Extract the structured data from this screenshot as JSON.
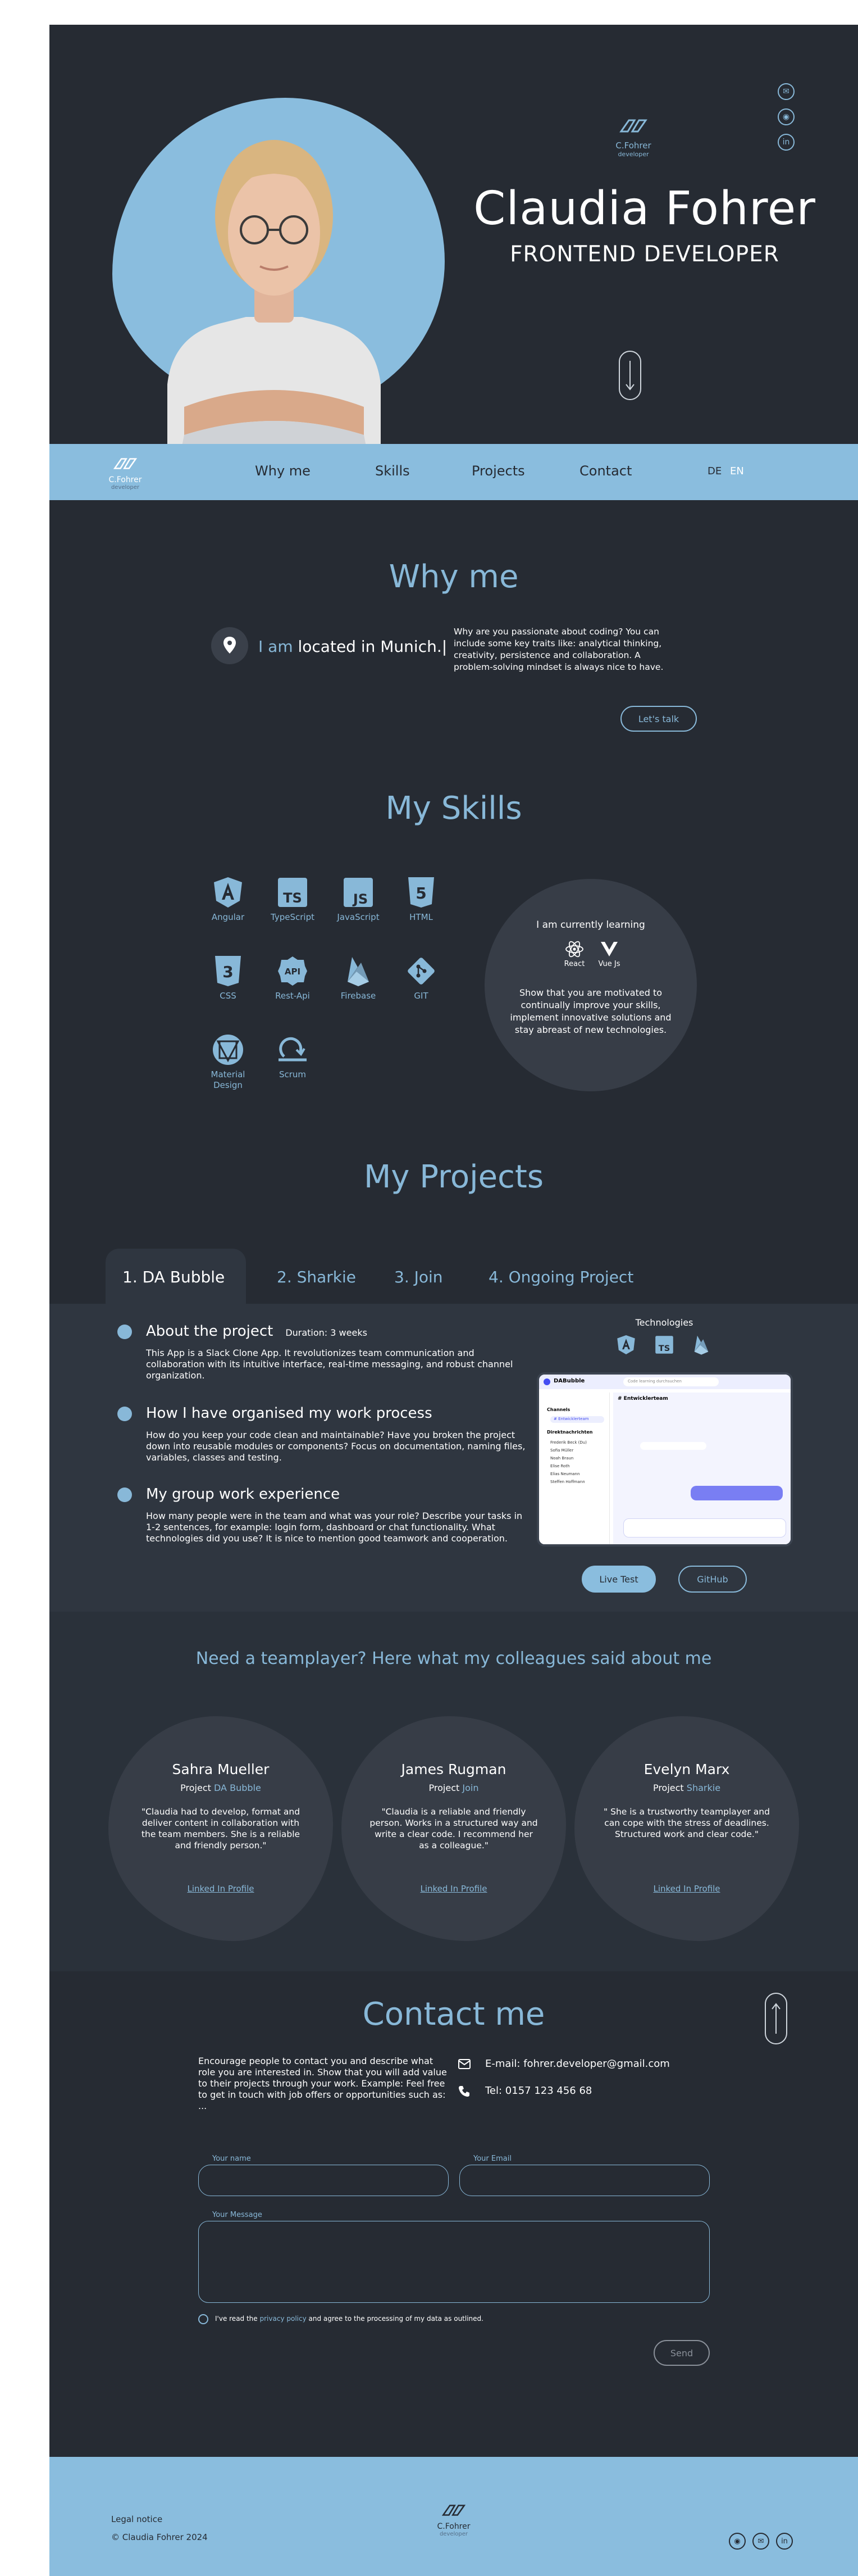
{
  "hero": {
    "brand_name": "C.Fohrer",
    "brand_sub": "developer",
    "name": "Claudia Fohrer",
    "role": "FRONTEND DEVELOPER"
  },
  "nav": {
    "items": [
      "Why me",
      "Skills",
      "Projects",
      "Contact"
    ],
    "lang_de": "DE",
    "lang_en": "EN"
  },
  "why": {
    "title": "Why me",
    "located_prefix": "I am",
    "located_rest": "located in Munich.|",
    "text": "Why are you passionate about coding? You can include some key traits like: analytical thinking, creativity, persistence and collaboration. A problem-solving mindset is always nice to have.",
    "cta": "Let's talk"
  },
  "skills": {
    "title": "My Skills",
    "items": [
      {
        "label": "Angular",
        "icon": "angular-icon"
      },
      {
        "label": "TypeScript",
        "icon": "typescript-icon"
      },
      {
        "label": "JavaScript",
        "icon": "javascript-icon"
      },
      {
        "label": "HTML",
        "icon": "html-icon"
      },
      {
        "label": "CSS",
        "icon": "css-icon"
      },
      {
        "label": "Rest-Api",
        "icon": "api-icon"
      },
      {
        "label": "Firebase",
        "icon": "firebase-icon"
      },
      {
        "label": "GIT",
        "icon": "git-icon"
      },
      {
        "label": "Material Design",
        "icon": "material-design-icon"
      },
      {
        "label": "Scrum",
        "icon": "scrum-icon"
      }
    ],
    "learning_title": "I am currently learning",
    "learning": [
      "React",
      "Vue Js"
    ],
    "learning_text": "Show that you are motivated to continually improve your skills, implement innovative solutions and stay abreast of new technologies."
  },
  "projects": {
    "title": "My Projects",
    "tabs": [
      "1. DA Bubble",
      "2. Sharkie",
      "3. Join",
      "4. Ongoing Project"
    ],
    "about_title": "About the project",
    "duration": "Duration: 3 weeks",
    "about_text": "This App is a Slack Clone App. It revolutionizes team communication and collaboration with its intuitive interface, real-time messaging, and robust channel organization.",
    "process_title": "How I have organised my work process",
    "process_text": "How do you keep your code clean and maintainable? Have you broken the project down into reusable modules or components? Focus on documentation, naming files, variables, classes and testing.",
    "group_title": "My group work experience",
    "group_text": "How many people were in the team and what was your role? Describe your tasks in 1-2 sentences, for example: login form, dashboard or chat functionality. What technologies did you use? It is nice to mention good teamwork and cooperation.",
    "tech_title": "Technologies",
    "mock_app_name": "DABubble",
    "mock_search": "Code learning durchsuchen",
    "mock_channels": "Channels",
    "mock_channel_item": "# Entwicklerteam",
    "mock_direct": "Direktnachrichten",
    "mock_channel_header": "# Entwicklerteam",
    "mock_members": [
      "Frederik Beck (Du)",
      "Sofia Müller",
      "Noah Braun",
      "Elise Roth",
      "Elias Neumann",
      "Steffen Hoffmann"
    ],
    "live_btn": "Live Test",
    "github_btn": "GitHub"
  },
  "testimonials": {
    "title": "Need a teamplayer? Here what my colleagues said about me",
    "project_prefix": "Project",
    "link_label": "Linked In Profile",
    "items": [
      {
        "name": "Sahra Mueller",
        "project": "DA Bubble",
        "quote": "\"Claudia had to develop, format and deliver content in collaboration with the team members. She is a reliable and friendly person.\""
      },
      {
        "name": "James Rugman",
        "project": "Join",
        "quote": "\"Claudia is a reliable and friendly person. Works in a structured way and write a clear code. I recommend her as a colleague.\""
      },
      {
        "name": "Evelyn Marx",
        "project": "Sharkie",
        "quote": "\" She is a trustworthy teamplayer and can cope with the stress of deadlines. Structured work and clear code.\""
      }
    ]
  },
  "contact": {
    "title": "Contact me",
    "text": "Encourage people to contact you and describe what role you are interested in. Show that you will add value to their projects through your work. Example: Feel free to get in touch with job offers or opportunities such as: ...",
    "email": "E-mail: fohrer.developer@gmail.com",
    "tel": "Tel: 0157 123 456 68",
    "name_label": "Your name",
    "email_label": "Your Email",
    "message_label": "Your Message",
    "privacy_prefix": "I've read the",
    "privacy_link": "privacy policy",
    "privacy_suffix": "and agree to the processing of my data as outlined.",
    "send": "Send"
  },
  "footer": {
    "legal": "Legal notice",
    "copyright": "© Claudia Fohrer 2024",
    "brand_name": "C.Fohrer",
    "brand_sub": "developer"
  },
  "colors": {
    "background": "#262b33",
    "accent": "#88b8d8",
    "band": "#8abdde"
  }
}
